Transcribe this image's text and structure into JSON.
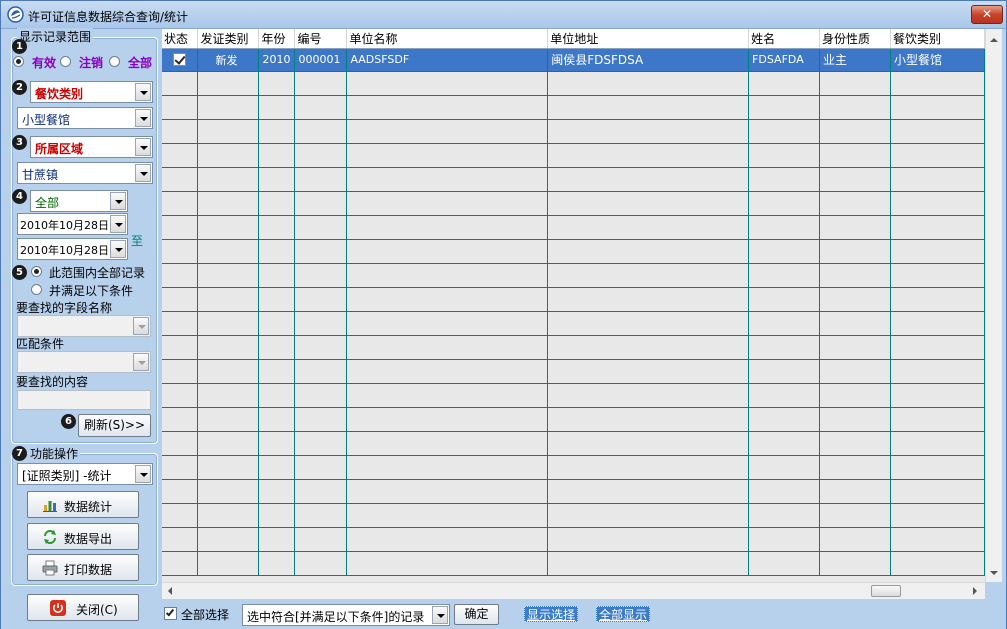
{
  "window": {
    "title": "许可证信息数据综合查询/统计",
    "close_glyph": "✕"
  },
  "filter": {
    "group_title": "显示记录范围",
    "status_options": [
      "有效",
      "注销",
      "全部"
    ],
    "status_selected": "有效",
    "food_category_label": "餐饮类别",
    "food_category_value": "小型餐馆",
    "region_label": "所属区域",
    "region_value": "甘蔗镇",
    "date_mode_value": "全部",
    "date_from": "2010年10月28日",
    "date_to": "2010年10月28日",
    "date_to_sep": "至",
    "scope_options": [
      "此范围内全部记录",
      "并满足以下条件"
    ],
    "scope_selected": "此范围内全部记录",
    "field_name_label": "要查找的字段名称",
    "match_label": "匹配条件",
    "content_label": "要查找的内容",
    "refresh_button": "刷新(S)>>"
  },
  "functions": {
    "group_title": "功能操作",
    "stat_mode_value": "[证照类别] -统计",
    "buttons": {
      "stats": "数据统计",
      "export": "数据导出",
      "print": "打印数据"
    }
  },
  "close_button": "关闭(C)",
  "step_numbers": [
    "1",
    "2",
    "3",
    "4",
    "5",
    "6",
    "7"
  ],
  "grid": {
    "columns": [
      "状态",
      "发证类别",
      "年份",
      "编号",
      "单位名称",
      "单位地址",
      "姓名",
      "身份性质",
      "餐饮类别"
    ],
    "rows": [
      {
        "checked": true,
        "cert_type": "新发",
        "year": "2010",
        "number": "000001",
        "unit_name": "AADSFSDF",
        "unit_address": "闽侯县FDSFDSA",
        "name": "FDSAFDA",
        "identity": "业主",
        "food_category": "小型餐馆"
      }
    ]
  },
  "bottom_bar": {
    "select_all_label": "全部选择",
    "select_all_checked": true,
    "selection_mode_value": "选中符合[并满足以下条件]的记录",
    "confirm_button": "确定",
    "show_selected": "显示选择",
    "show_all": "全部显示"
  },
  "colors": {
    "panel_bg": "#b7d0ec",
    "selected_row": "#3c77c8",
    "grid_lines": "#008080",
    "emphasis_red": "#cc0000",
    "emphasis_purple": "#8a00c0"
  }
}
